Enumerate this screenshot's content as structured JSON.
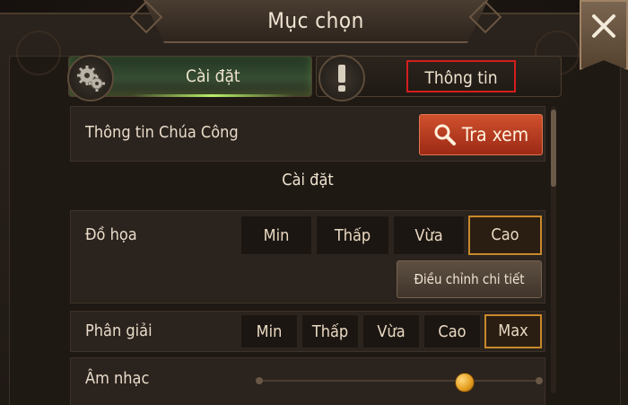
{
  "title": "Mục chọn",
  "tabs": [
    {
      "label": "Cài đặt",
      "active": true,
      "icon": "gear-icon"
    },
    {
      "label": "Thông tin",
      "active": false,
      "icon": "exclamation-icon"
    }
  ],
  "lord_info": {
    "label": "Thông tin Chúa Công",
    "button": "Tra xem"
  },
  "section_title": "Cài đặt",
  "graphics": {
    "label": "Đồ họa",
    "options": [
      "Min",
      "Thấp",
      "Vừa",
      "Cao"
    ],
    "selected": "Cao",
    "detail_button": "Điều chỉnh chi tiết"
  },
  "resolution": {
    "label": "Phân giải",
    "options": [
      "Min",
      "Thấp",
      "Vừa",
      "Cao",
      "Max"
    ],
    "selected": "Max"
  },
  "music": {
    "label": "Âm nhạc",
    "level": 0.73
  },
  "colors": {
    "accent": "#c8892b",
    "search_button": "#b83a1e",
    "active_tab_glow": "#b8f06a",
    "highlight_box": "#d41e1e"
  }
}
